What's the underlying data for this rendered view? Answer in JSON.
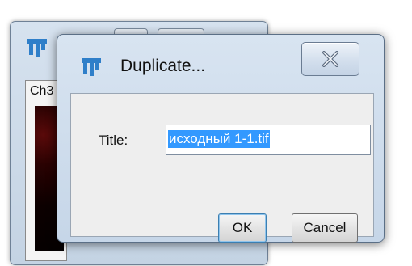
{
  "background_window": {
    "title_fragment": "",
    "channel_label": "Ch3"
  },
  "dialog": {
    "title": "Duplicate...",
    "title_label": "Title:",
    "title_value": "исходный 1-1.tif",
    "ok_label": "OK",
    "cancel_label": "Cancel"
  },
  "colors": {
    "title_bar": "#c6d6e8",
    "selection": "#3399ff",
    "client": "#eeeeee"
  },
  "icons": [
    "imagej-icon",
    "close-icon"
  ]
}
